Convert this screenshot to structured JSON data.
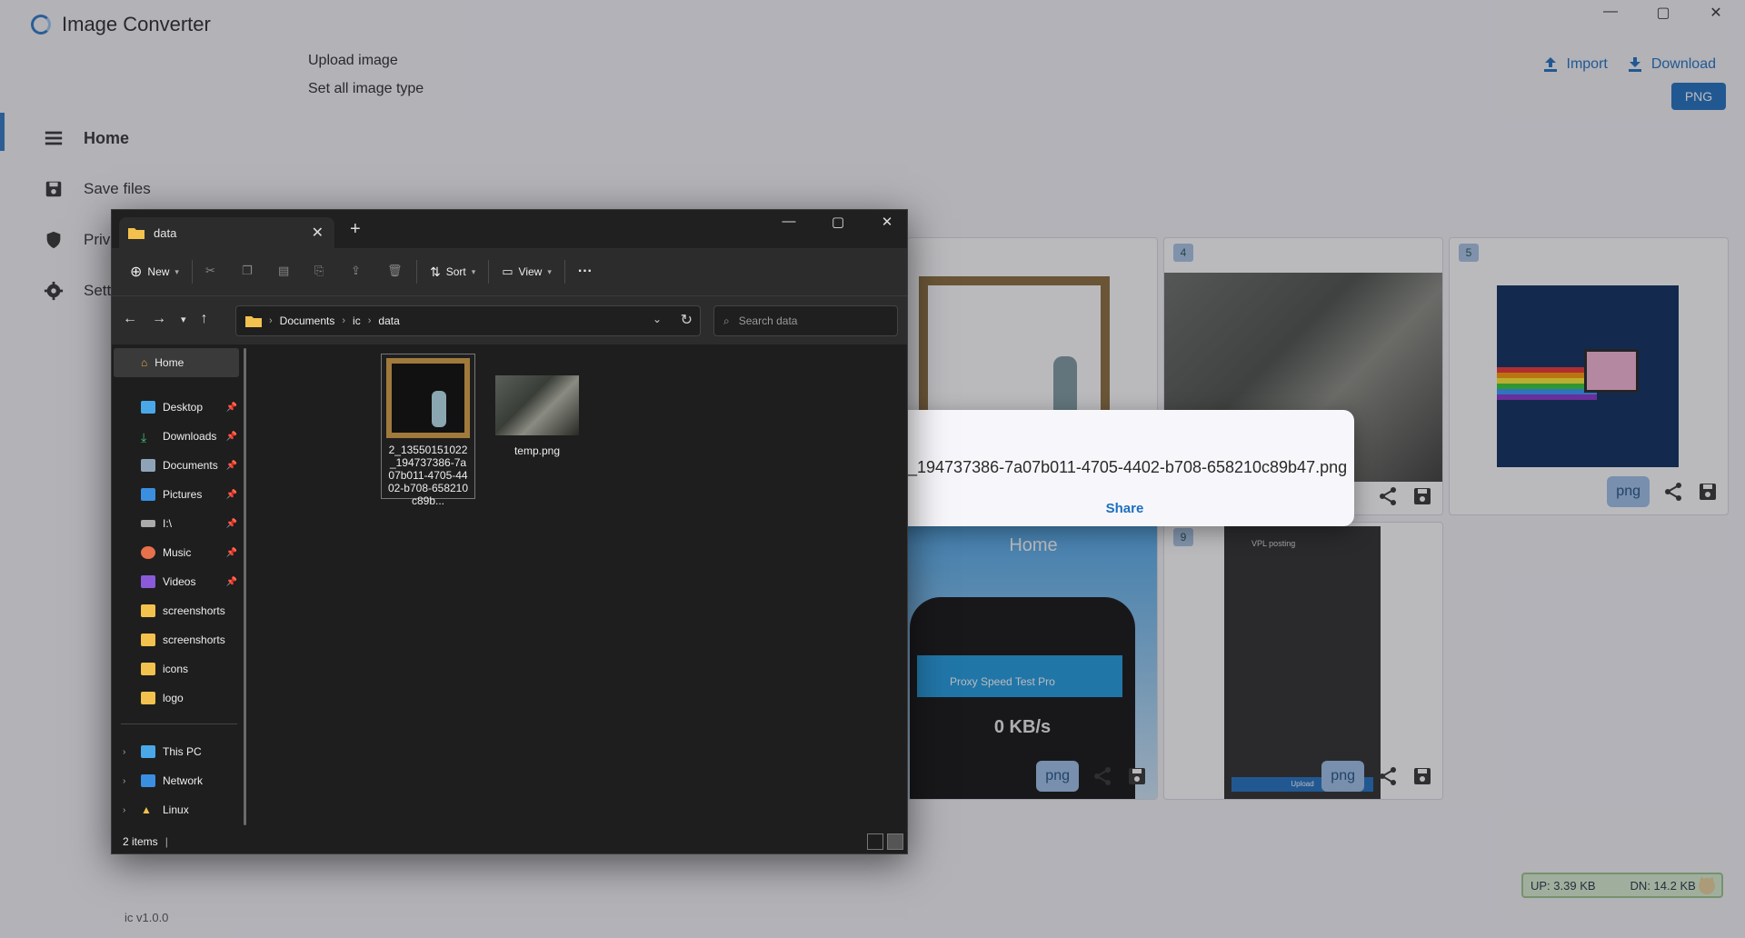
{
  "app": {
    "title": "Image Converter",
    "win_controls": [
      "—",
      "▢",
      "✕"
    ],
    "top_links": [
      "Upload image",
      "Set all image type"
    ],
    "nav": [
      {
        "label": "Home",
        "icon": "menu-icon"
      },
      {
        "label": "Save files",
        "icon": "save-icon"
      },
      {
        "label": "Priva",
        "icon": "shield-icon"
      },
      {
        "label": "Setti",
        "icon": "gear-icon"
      }
    ],
    "actions": {
      "import": "Import",
      "download": "Download",
      "format": "PNG"
    },
    "cards": [
      {
        "index": "",
        "chip": ""
      },
      {
        "index": "4",
        "chip": ""
      },
      {
        "index": "5",
        "chip": "png"
      },
      {
        "index": "",
        "chip": "png",
        "header": "Home",
        "speed_title": "Proxy Speed Test Pro",
        "speed_value": "0 KB/s"
      },
      {
        "index": "9",
        "chip": "png",
        "title": "VPL posting",
        "upload": "Upload"
      }
    ],
    "version": "ic v1.0.0",
    "net": {
      "up": "UP: 3.39 KB",
      "down": "DN: 14.2 KB"
    }
  },
  "toast": {
    "message": "_194737386-7a07b011-4705-4402-b708-658210c89b47.png",
    "action": "Share"
  },
  "explorer": {
    "tab_title": "data",
    "window_controls": [
      "—",
      "▢",
      "✕"
    ],
    "toolbar": {
      "new": "New",
      "sort": "Sort",
      "view": "View",
      "more": "···"
    },
    "breadcrumb": [
      "Documents",
      "ic",
      "data"
    ],
    "search_placeholder": "Search data",
    "sidebar": {
      "home": "Home",
      "pinned": [
        "Desktop",
        "Downloads",
        "Documents",
        "Pictures",
        "I:\\",
        "Music",
        "Videos"
      ],
      "folders": [
        "screenshorts",
        "screenshorts",
        "icons",
        "logo"
      ],
      "locations": [
        "This PC",
        "Network",
        "Linux"
      ]
    },
    "files": [
      {
        "name": "2_13550151022_194737386-7a07b011-4705-4402-b708-658210c89b..."
      },
      {
        "name": "temp.png"
      }
    ],
    "status": "2 items"
  },
  "colors": {
    "accent": "#1f6fc0",
    "explorer_bg": "#1e1e1e",
    "toast_bg": "#f7f7fb"
  }
}
